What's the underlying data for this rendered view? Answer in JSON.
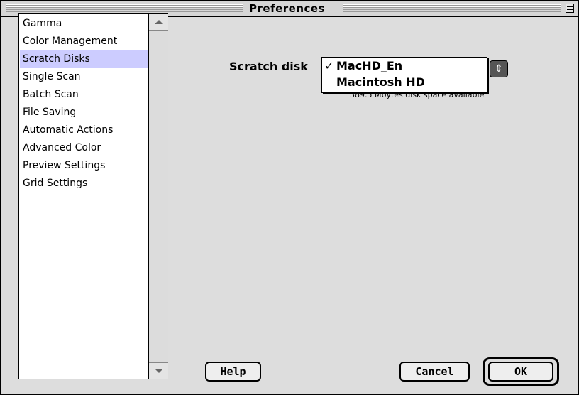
{
  "window": {
    "title": "Preferences"
  },
  "categories": [
    {
      "label": "Gamma"
    },
    {
      "label": "Color Management"
    },
    {
      "label": "Scratch Disks"
    },
    {
      "label": "Single Scan"
    },
    {
      "label": "Batch Scan"
    },
    {
      "label": "File Saving"
    },
    {
      "label": "Automatic Actions"
    },
    {
      "label": "Advanced Color"
    },
    {
      "label": "Preview Settings"
    },
    {
      "label": "Grid Settings"
    }
  ],
  "selected_category": "Scratch Disks",
  "scratch": {
    "label": "Scratch disk",
    "check_mark": "✓",
    "options": [
      "MacHD_En",
      "Macintosh HD"
    ],
    "selected": "MacHD_En",
    "disk_info": "389.5 Mbytes disk space available"
  },
  "buttons": {
    "help": "Help",
    "cancel": "Cancel",
    "ok": "OK"
  },
  "colors": {
    "selection": "#ccccff",
    "window_bg": "#dddddd"
  }
}
